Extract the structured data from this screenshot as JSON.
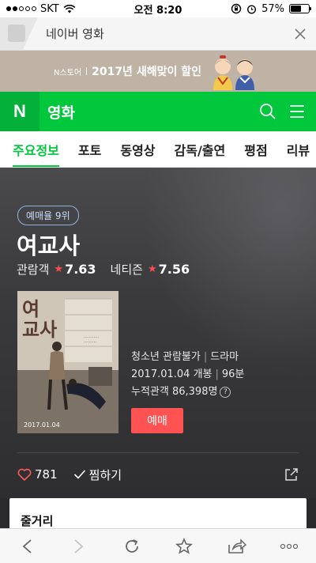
{
  "status_bar": {
    "carrier": "SKT",
    "time": "오전 8:20",
    "battery": "57%",
    "battery_level": 0.57
  },
  "browser_tab": {
    "title": "네이버 영화"
  },
  "banner": {
    "store": "N스토어",
    "text": "2017년 새해맞이 할인"
  },
  "header": {
    "logo": "N",
    "section": "영화"
  },
  "tabs": [
    {
      "label": "주요정보",
      "active": true
    },
    {
      "label": "포토"
    },
    {
      "label": "동영상"
    },
    {
      "label": "감독/출연"
    },
    {
      "label": "평점"
    },
    {
      "label": "리뷰"
    }
  ],
  "movie": {
    "rank_badge": "예매율 9위",
    "title": "여교사",
    "audience_label": "관람객",
    "audience_score": "7.63",
    "netizen_label": "네티즌",
    "netizen_score": "7.56",
    "rating": "청소년 관람불가",
    "genre": "드라마",
    "release": "2017.01.04 개봉",
    "runtime": "96분",
    "cumulative": "누적관객 86,398명",
    "poster_title": "여\n교사",
    "poster_date": "2017.01.04",
    "reserve_label": "예매",
    "likes": "781",
    "wish_label": "찜하기"
  },
  "synopsis": {
    "title": "줄거리"
  },
  "colors": {
    "naver_green": "#00c73c",
    "reserve_red": "#ff5252",
    "star_red": "#ff4d4d"
  }
}
